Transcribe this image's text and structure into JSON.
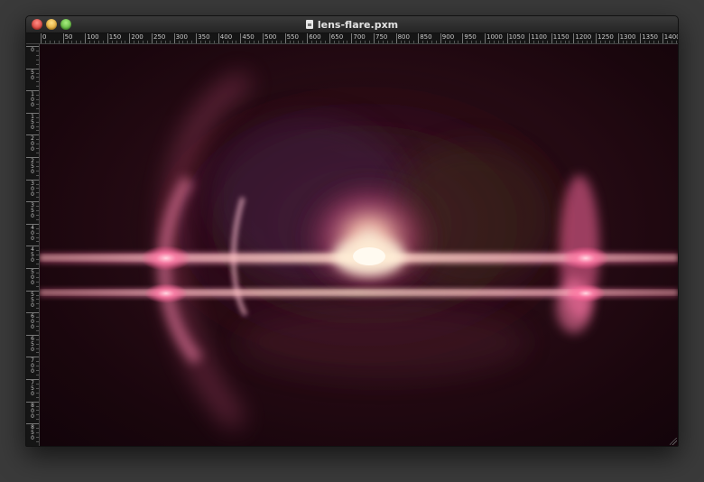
{
  "window": {
    "title": "lens-flare.pxm"
  },
  "controls": {
    "close": "close",
    "minimize": "minimize",
    "zoom": "zoom"
  },
  "horizontal_ruler": [
    "0",
    "50",
    "100",
    "150",
    "200",
    "250",
    "300",
    "350",
    "400",
    "450",
    "500",
    "550",
    "600",
    "650",
    "700",
    "750",
    "800",
    "850",
    "900",
    "950",
    "1000",
    "1050",
    "1100",
    "1150",
    "1200",
    "1250",
    "1300",
    "1350",
    "1400"
  ],
  "vertical_ruler": [
    "0",
    "50",
    "100",
    "150",
    "200",
    "250",
    "300",
    "350",
    "400",
    "450",
    "500",
    "550",
    "600",
    "650",
    "700",
    "750",
    "800",
    "850"
  ],
  "colors": {
    "flare_core": "#ffd2b4",
    "flare_pink": "#ff6aa0",
    "background": "#1a060d"
  },
  "icons": {
    "document": "document-icon"
  }
}
